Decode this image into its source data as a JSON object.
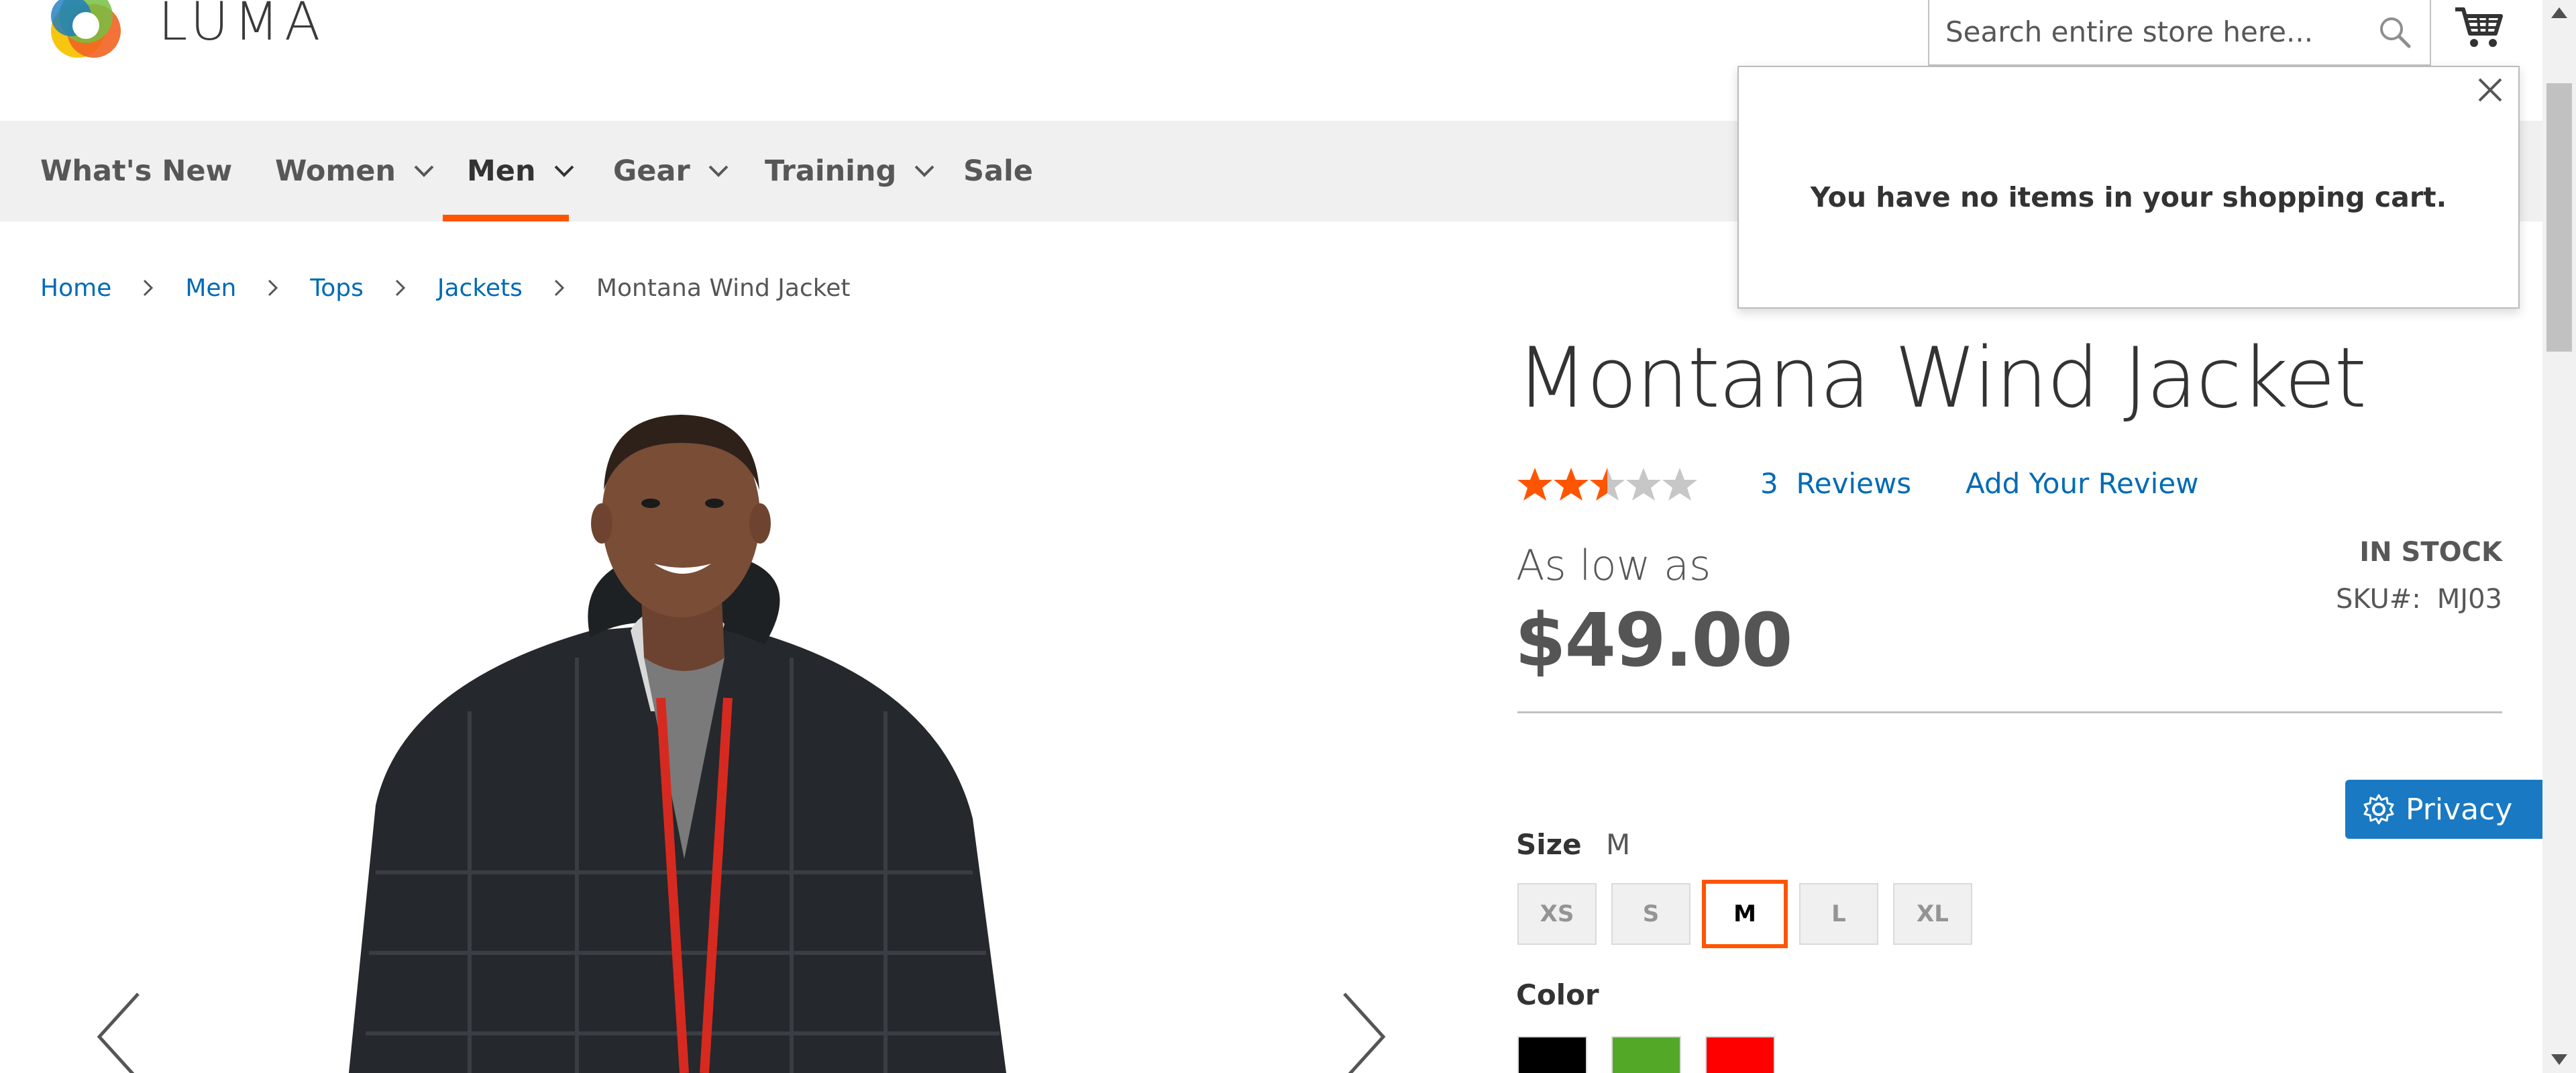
{
  "header": {
    "logo_text": "LUMA",
    "search_placeholder": "Search entire store here...",
    "icons": [
      "luma-logo-icon",
      "search-icon",
      "cart-icon"
    ]
  },
  "nav": {
    "items": [
      {
        "label": "What's New",
        "has_dropdown": false
      },
      {
        "label": "Women",
        "has_dropdown": true
      },
      {
        "label": "Men",
        "has_dropdown": true,
        "active": true
      },
      {
        "label": "Gear",
        "has_dropdown": true
      },
      {
        "label": "Training",
        "has_dropdown": true
      },
      {
        "label": "Sale",
        "has_dropdown": false
      }
    ],
    "accent_color": "#ff5501"
  },
  "minicart": {
    "message": "You have no items in your shopping cart."
  },
  "breadcrumbs": {
    "items": [
      "Home",
      "Men",
      "Tops",
      "Jackets"
    ],
    "current": "Montana Wind Jacket"
  },
  "product": {
    "title": "Montana Wind Jacket",
    "rating_stars": 2.5,
    "rating_max": 5,
    "reviews_count": "3",
    "reviews_label": "Reviews",
    "add_review": "Add Your Review",
    "price_prefix": "As low as",
    "price": "$49.00",
    "stock": "IN STOCK",
    "sku_label": "SKU#:",
    "sku": "MJ03",
    "size_label": "Size",
    "size_selected": "M",
    "sizes": [
      "XS",
      "S",
      "M",
      "L",
      "XL"
    ],
    "color_label": "Color",
    "colors": [
      "#000000",
      "#53a828",
      "#ff0000"
    ]
  },
  "privacy": {
    "label": "Privacy",
    "color": "#1979c3"
  },
  "colors": {
    "link": "#006bb4",
    "accent": "#ff5501",
    "star_filled": "#ff5501",
    "star_empty": "#c7c7c7"
  }
}
